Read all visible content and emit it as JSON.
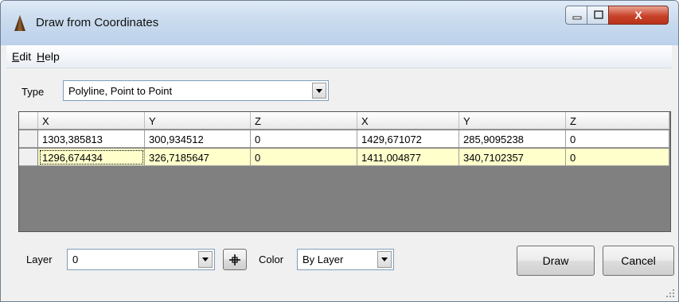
{
  "window": {
    "title": "Draw from Coordinates",
    "close_label": "X",
    "icon": "app-cone-icon"
  },
  "menu": {
    "edit_accel": "E",
    "edit_rest": "dit",
    "help_accel": "H",
    "help_rest": "elp"
  },
  "type": {
    "label": "Type",
    "value": "Polyline, Point to Point"
  },
  "grid": {
    "headers": [
      "X",
      "Y",
      "Z",
      "X",
      "Y",
      "Z"
    ],
    "rows": [
      [
        "1303,385813",
        "300,934512",
        "0",
        "1429,671072",
        "285,9095238",
        "0"
      ],
      [
        "1296,674434",
        "326,7185647",
        "0",
        "1411,004877",
        "340,7102357",
        "0"
      ]
    ],
    "selected_row_color": "#ffffcc"
  },
  "layer": {
    "label": "Layer",
    "value": "0",
    "pick_icon": "crosshair-icon"
  },
  "color": {
    "label": "Color",
    "value": "By Layer"
  },
  "buttons": {
    "draw": "Draw",
    "cancel": "Cancel"
  }
}
